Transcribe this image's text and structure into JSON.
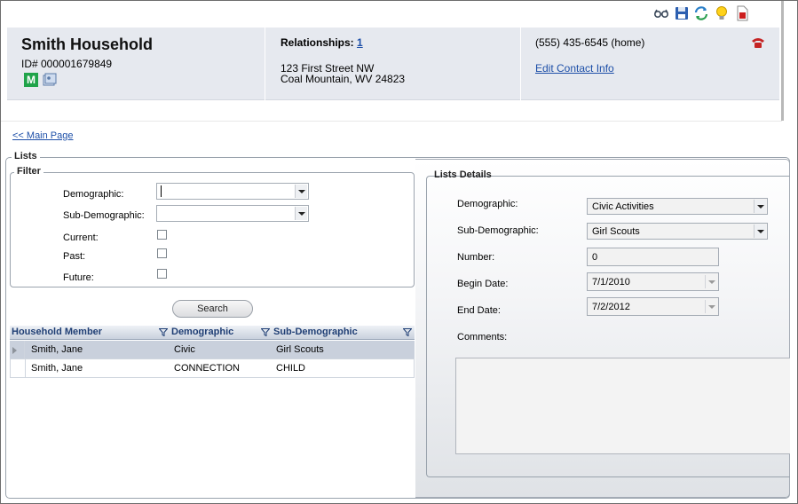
{
  "toolbar": {
    "icons": [
      "glasses-icon",
      "save-icon",
      "refresh-icon",
      "lightbulb-icon",
      "pdf-report-icon"
    ]
  },
  "header": {
    "household_name": "Smith Household",
    "id_label": "ID# 000001679849",
    "member_badge": "M",
    "relationships_label": "Relationships:",
    "relationships_count": "1",
    "address_line1": "123 First Street NW",
    "address_line2": "Coal Mountain, WV 24823",
    "phone": "(555) 435-6545 (home)",
    "edit_contact_link": "Edit Contact Info"
  },
  "nav": {
    "main_page_link": "<< Main Page"
  },
  "lists": {
    "section_title": "Lists",
    "filter": {
      "legend": "Filter",
      "demographic_label": "Demographic:",
      "demographic_value": "",
      "sub_demographic_label": "Sub-Demographic:",
      "sub_demographic_value": "",
      "current_label": "Current:",
      "past_label": "Past:",
      "future_label": "Future:",
      "search_button": "Search"
    },
    "grid": {
      "columns": [
        "Household Member",
        "Demographic",
        "Sub-Demographic"
      ],
      "rows": [
        {
          "member": "Smith, Jane",
          "demographic": "Civic",
          "sub_demographic": "Girl Scouts",
          "selected": true
        },
        {
          "member": "Smith, Jane",
          "demographic": "CONNECTION",
          "sub_demographic": "CHILD",
          "selected": false
        }
      ]
    }
  },
  "details": {
    "legend": "Lists Details",
    "demographic_label": "Demographic:",
    "demographic_value": "Civic Activities",
    "sub_demographic_label": "Sub-Demographic:",
    "sub_demographic_value": "Girl Scouts",
    "number_label": "Number:",
    "number_value": "0",
    "begin_date_label": "Begin Date:",
    "begin_date_value": "7/1/2010",
    "end_date_label": "End Date:",
    "end_date_value": "7/2/2012",
    "comments_label": "Comments:",
    "comments_value": ""
  },
  "colors": {
    "header_bg": "#e6e9ef",
    "link": "#1d4fa8",
    "grid_header_text": "#1f3e74",
    "selected_row": "#c9d0dc"
  }
}
